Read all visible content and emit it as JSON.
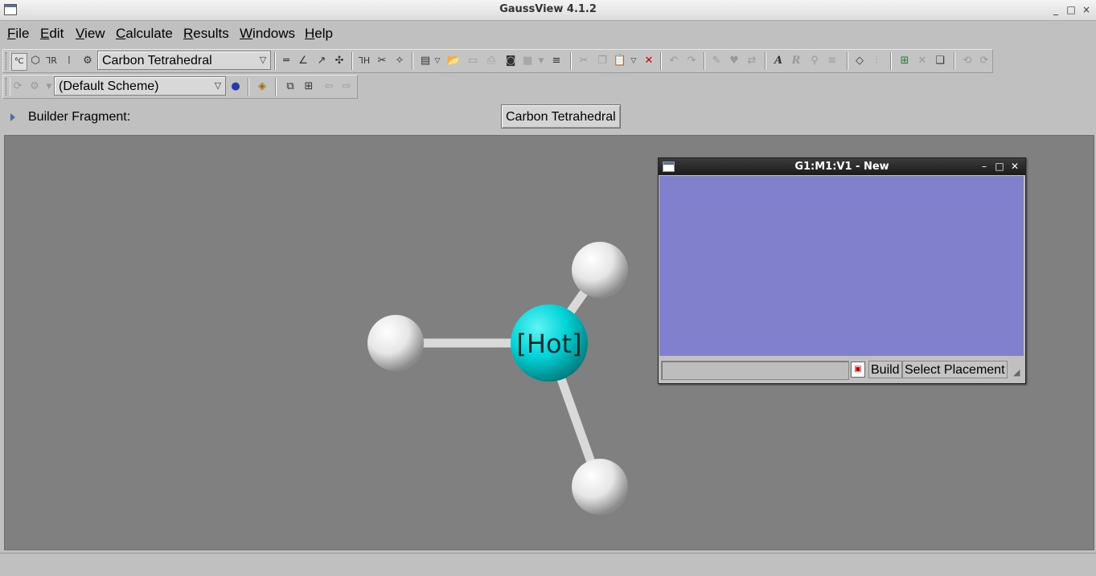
{
  "window": {
    "title": "GaussView 4.1.2",
    "controls": {
      "minimize": "_",
      "maximize": "□",
      "close": "×"
    }
  },
  "menu": [
    {
      "label": "File",
      "ul": "F",
      "rest": "ile"
    },
    {
      "label": "Edit",
      "ul": "E",
      "rest": "dit"
    },
    {
      "label": "View",
      "ul": "V",
      "rest": "iew"
    },
    {
      "label": "Calculate",
      "ul": "C",
      "rest": "alculate"
    },
    {
      "label": "Results",
      "ul": "R",
      "rest": "esults"
    },
    {
      "label": "Windows",
      "ul": "W",
      "rest": "indows"
    },
    {
      "label": "Help",
      "ul": "H",
      "rest": "elp"
    }
  ],
  "toolbar": {
    "fragment_combo": "Carbon Tetrahedral",
    "scheme_combo": "(Default Scheme)"
  },
  "builder": {
    "fragment_label": "Builder Fragment:",
    "fragment_button": "Carbon Tetrahedral"
  },
  "molecule": {
    "center_label": "[Hot]",
    "center_color": "#00d8dc",
    "hydrogen_color": "#f0f0f0"
  },
  "subwindow": {
    "title": "G1:M1:V1 - New",
    "canvas_color": "#8080cc",
    "status_value": "",
    "build_label": "Build",
    "placement_label": "Select Placement"
  }
}
